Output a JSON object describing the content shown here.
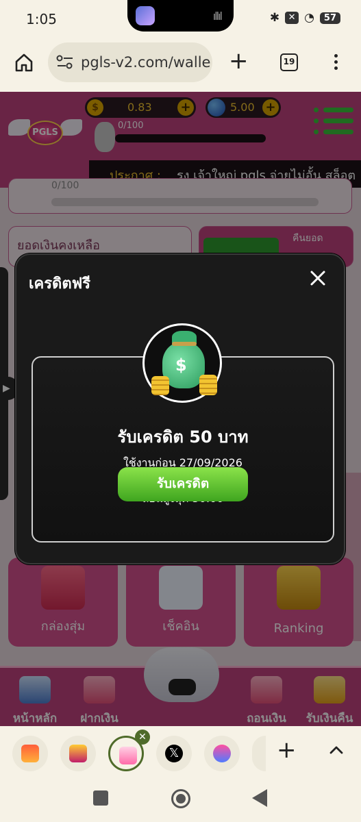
{
  "status": {
    "time": "1:05",
    "battery": "57"
  },
  "browser": {
    "url": "pgls-v2.com/walle",
    "tab_count": "19"
  },
  "site": {
    "logo_text": "PGLS",
    "coin_balance": "0.83",
    "gem_balance": "5.00",
    "level_progress": "0/100",
    "announce_label": "ประกาศ :",
    "announce_text": "รง เจ้าใหญ่ pgls จ่ายไม่อั้น สล็อต",
    "progress_text": "0/100",
    "balance_label": "ยอดเงินคงเหลือ",
    "refund_label": "คืนยอด",
    "tiles": [
      {
        "label": "กล่องสุ่ม"
      },
      {
        "label": "เช็คอิน"
      },
      {
        "label": "Ranking"
      }
    ],
    "bottom_nav": [
      {
        "label": "หน้าหลัก"
      },
      {
        "label": "ฝากเงิน"
      },
      {
        "label": "ถอนเงิน"
      },
      {
        "label": "รับเงินคืน"
      }
    ]
  },
  "modal": {
    "title": "เครดิตฟรี",
    "credit_title": "รับเครดิต 50 บาท",
    "use_before": "ใช้งานก่อน 27/09/2026",
    "max_turnover": "เทิร์นสูงสุด 750.00",
    "max_withdraw": "ถอนสูงสุด 50.00",
    "claim_button": "รับเครดิต"
  },
  "colors": {
    "site_pink": "#c0427e",
    "modal_bg": "#1a1a1a",
    "claim_green": "#5cc433",
    "gold": "#f2c431"
  }
}
